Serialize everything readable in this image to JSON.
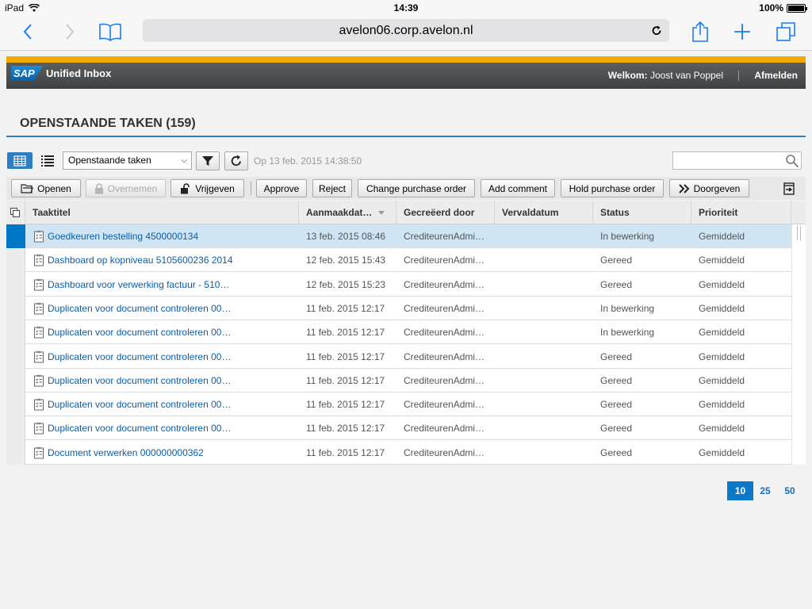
{
  "statusbar": {
    "device": "iPad",
    "time": "14:39",
    "battery": "100%"
  },
  "browser": {
    "url": "avelon06.corp.avelon.nl"
  },
  "app": {
    "logo": "SAP",
    "name": "Unified Inbox",
    "welcome_label": "Welkom:",
    "user": "Joost van Poppel",
    "logout": "Afmelden"
  },
  "page": {
    "title": "OPENSTAANDE TAKEN (159)"
  },
  "filter": {
    "selected": "Openstaande taken",
    "refreshed": "Op 13 feb. 2015 14:38:50"
  },
  "toolbar": {
    "open": "Openen",
    "claim": "Overnemen",
    "release": "Vrijgeven",
    "approve": "Approve",
    "reject": "Reject",
    "change_po": "Change purchase order",
    "add_comment": "Add comment",
    "hold_po": "Hold purchase order",
    "forward": "Doorgeven"
  },
  "table": {
    "columns": [
      "Taaktitel",
      "Aanmaakdat…",
      "Gecreëerd door",
      "Vervaldatum",
      "Status",
      "Prioriteit"
    ],
    "rows": [
      {
        "title": "Goedkeuren bestelling 4500000134",
        "created": "13 feb. 2015 08:46",
        "by": "CrediteurenAdmi…",
        "due": "",
        "status": "In bewerking",
        "priority": "Gemiddeld"
      },
      {
        "title": "Dashboard op kopniveau 5105600236 2014",
        "created": "12 feb. 2015 15:43",
        "by": "CrediteurenAdmi…",
        "due": "",
        "status": "Gereed",
        "priority": "Gemiddeld"
      },
      {
        "title": "Dashboard voor verwerking factuur - 510…",
        "created": "12 feb. 2015 15:23",
        "by": "CrediteurenAdmi…",
        "due": "",
        "status": "Gereed",
        "priority": "Gemiddeld"
      },
      {
        "title": "Duplicaten voor document controleren 00…",
        "created": "11 feb. 2015 12:17",
        "by": "CrediteurenAdmi…",
        "due": "",
        "status": "In bewerking",
        "priority": "Gemiddeld"
      },
      {
        "title": "Duplicaten voor document controleren 00…",
        "created": "11 feb. 2015 12:17",
        "by": "CrediteurenAdmi…",
        "due": "",
        "status": "In bewerking",
        "priority": "Gemiddeld"
      },
      {
        "title": "Duplicaten voor document controleren 00…",
        "created": "11 feb. 2015 12:17",
        "by": "CrediteurenAdmi…",
        "due": "",
        "status": "Gereed",
        "priority": "Gemiddeld"
      },
      {
        "title": "Duplicaten voor document controleren 00…",
        "created": "11 feb. 2015 12:17",
        "by": "CrediteurenAdmi…",
        "due": "",
        "status": "Gereed",
        "priority": "Gemiddeld"
      },
      {
        "title": "Duplicaten voor document controleren 00…",
        "created": "11 feb. 2015 12:17",
        "by": "CrediteurenAdmi…",
        "due": "",
        "status": "Gereed",
        "priority": "Gemiddeld"
      },
      {
        "title": "Duplicaten voor document controleren 00…",
        "created": "11 feb. 2015 12:17",
        "by": "CrediteurenAdmi…",
        "due": "",
        "status": "Gereed",
        "priority": "Gemiddeld"
      },
      {
        "title": "Document verwerken 000000000362",
        "created": "11 feb. 2015 12:17",
        "by": "CrediteurenAdmi…",
        "due": "",
        "status": "Gereed",
        "priority": "Gemiddeld"
      }
    ]
  },
  "pager": {
    "sizes": [
      "10",
      "25",
      "50"
    ],
    "active": "10"
  },
  "icons": {
    "back": "chevron-left-icon",
    "forward": "chevron-right-icon",
    "bookmarks": "book-icon",
    "reload": "reload-icon",
    "share": "share-icon",
    "new_tab": "plus-icon",
    "tabs": "tabs-icon",
    "grid_view": "grid-view-icon",
    "list_view": "list-view-icon",
    "filter": "filter-icon",
    "refresh": "refresh-icon",
    "search": "search-icon",
    "task": "task-icon"
  },
  "colors": {
    "accent": "#2b7fc2",
    "sap_gold": "#f0ab00",
    "selected_row": "#cfe5f4",
    "link": "#0b5ea8",
    "ios_blue": "#1a7cf5"
  }
}
